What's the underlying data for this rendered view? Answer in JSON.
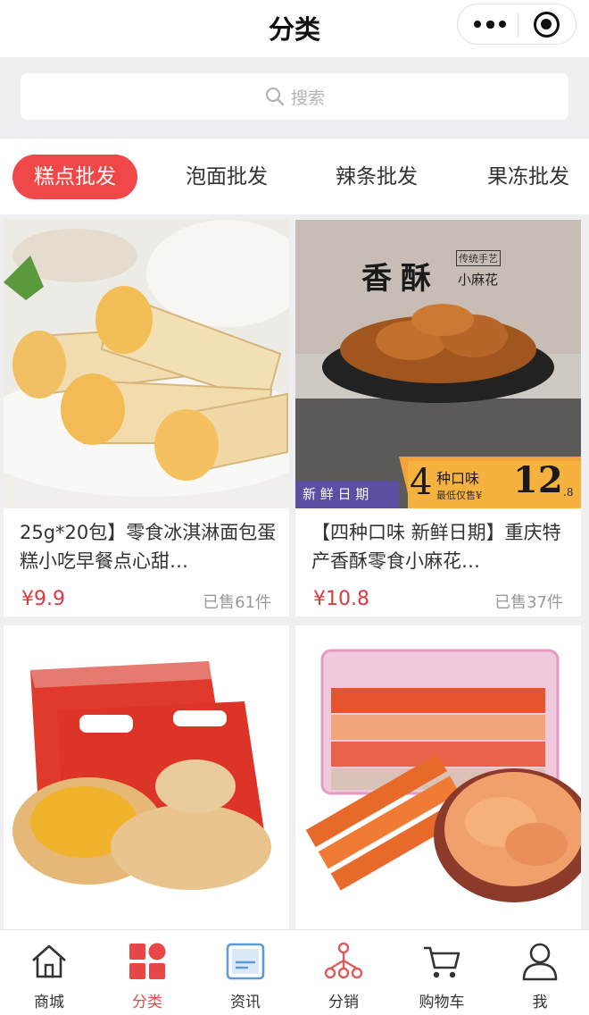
{
  "header": {
    "title": "分类"
  },
  "search": {
    "placeholder": "搜索"
  },
  "tabs": [
    {
      "label": "糕点批发",
      "active": true
    },
    {
      "label": "泡面批发",
      "active": false
    },
    {
      "label": "辣条批发",
      "active": false
    },
    {
      "label": "果冻批发",
      "active": false
    }
  ],
  "products": [
    {
      "name": "25g*20包】零食冰淇淋面包蛋糕小吃早餐点心甜…",
      "price": "¥9.9",
      "sold": "已售61件",
      "image": "ice-cream-cone-bread"
    },
    {
      "name": "【四种口味 新鲜日期】重庆特产香酥零食小麻花…",
      "price": "¥10.8",
      "sold": "已售37件",
      "image": "mahua-twist-snack",
      "image_text": {
        "brand": "香酥",
        "tag": "传统手艺",
        "sub": "小麻花",
        "fresh": "新 鲜 日 期",
        "flavor_num": "4",
        "flavor": "种口味",
        "min_price_label": "最低仅售¥",
        "big_price": "12",
        "big_price_dec": ".8"
      }
    },
    {
      "name": "",
      "price": "",
      "sold": "",
      "image": "meat-floss-pastry-boxes"
    },
    {
      "name": "",
      "price": "",
      "sold": "",
      "image": "twist-snack-box"
    }
  ],
  "bottom_nav": [
    {
      "label": "商城",
      "icon": "home-icon",
      "active": false
    },
    {
      "label": "分类",
      "icon": "category-icon",
      "active": true
    },
    {
      "label": "资讯",
      "icon": "news-icon",
      "active": false
    },
    {
      "label": "分销",
      "icon": "distribution-icon",
      "active": false
    },
    {
      "label": "购物车",
      "icon": "cart-icon",
      "active": false
    },
    {
      "label": "我",
      "icon": "user-icon",
      "active": false
    }
  ],
  "colors": {
    "accent": "#f04848",
    "price": "#e0383e",
    "background": "#efeff2"
  }
}
